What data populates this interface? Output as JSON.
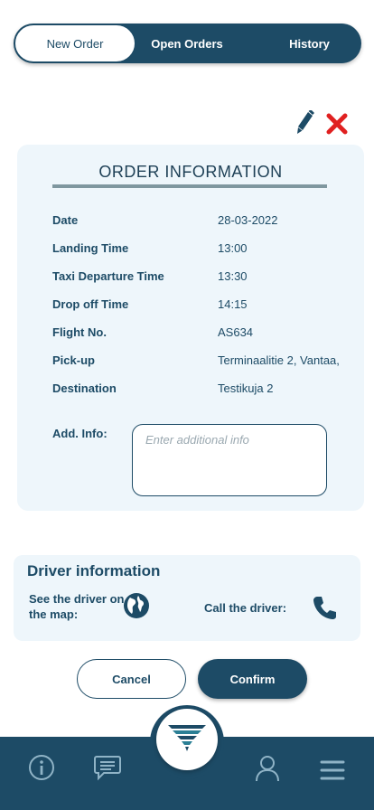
{
  "tabs": [
    {
      "label": "New Order",
      "active": true
    },
    {
      "label": "Open Orders",
      "active": false
    },
    {
      "label": "History",
      "active": false
    }
  ],
  "actions": {
    "edit_icon": "pencil-icon",
    "delete_icon": "close-icon"
  },
  "order": {
    "title": "ORDER INFORMATION",
    "rows": [
      {
        "label": "Date",
        "value": "28-03-2022"
      },
      {
        "label": "Landing Time",
        "value": "13:00"
      },
      {
        "label": "Taxi Departure Time",
        "value": "13:30"
      },
      {
        "label": "Drop off Time",
        "value": "14:15"
      },
      {
        "label": "Flight No.",
        "value": "AS634"
      },
      {
        "label": "Pick-up",
        "value": "Terminaalitie 2, Vantaa,"
      },
      {
        "label": "Destination",
        "value": "Testikuja 2"
      }
    ],
    "add_info_label": "Add. Info:",
    "add_info_placeholder": "Enter additional info",
    "add_info_value": ""
  },
  "driver": {
    "title": "Driver information",
    "map_label": "See the driver on the map:",
    "call_label": "Call the driver:"
  },
  "buttons": {
    "cancel": "Cancel",
    "confirm": "Confirm"
  },
  "nav": {
    "items": [
      "info-icon",
      "chat-icon",
      "logo",
      "profile-icon",
      "menu-icon"
    ]
  },
  "colors": {
    "primary": "#1d4b66",
    "card_bg": "#eef6fb",
    "danger": "#e02020"
  }
}
